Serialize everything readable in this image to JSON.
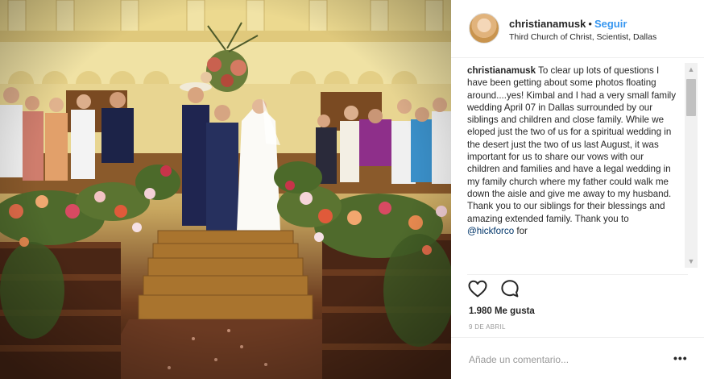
{
  "post": {
    "username": "christianamusk",
    "separator": "•",
    "follow_label": "Seguir",
    "location": "Third Church of Christ, Scientist, Dallas",
    "caption_user": "christianamusk",
    "caption_text": " To clear up lots of questions I have been getting about some photos floating around....yes! Kimbal and I had a very small family wedding April 07 in Dallas surrounded by our siblings and children and close family. While we eloped just the two of us for a spiritual wedding in the desert just the two of us last August, it was important for us to share our vows with our children and families and have a legal wedding in my family church where my father could walk me down the aisle and give me away to my husband. Thank you to our siblings for their blessings and amazing extended family. Thank you to ",
    "caption_mention": "@hickforco",
    "caption_tail": " for",
    "likes": "1.980 Me gusta",
    "date": "9 DE ABRIL",
    "comment_placeholder": "Añade un comentario...",
    "more_label": "•••"
  },
  "icons": {
    "like": "heart-icon",
    "comment": "comment-bubble-icon",
    "scroll_up": "scroll-up-arrow-icon",
    "scroll_down": "scroll-down-arrow-icon"
  },
  "colors": {
    "link_blue": "#3897f0",
    "text": "#262626",
    "muted": "#999999"
  }
}
